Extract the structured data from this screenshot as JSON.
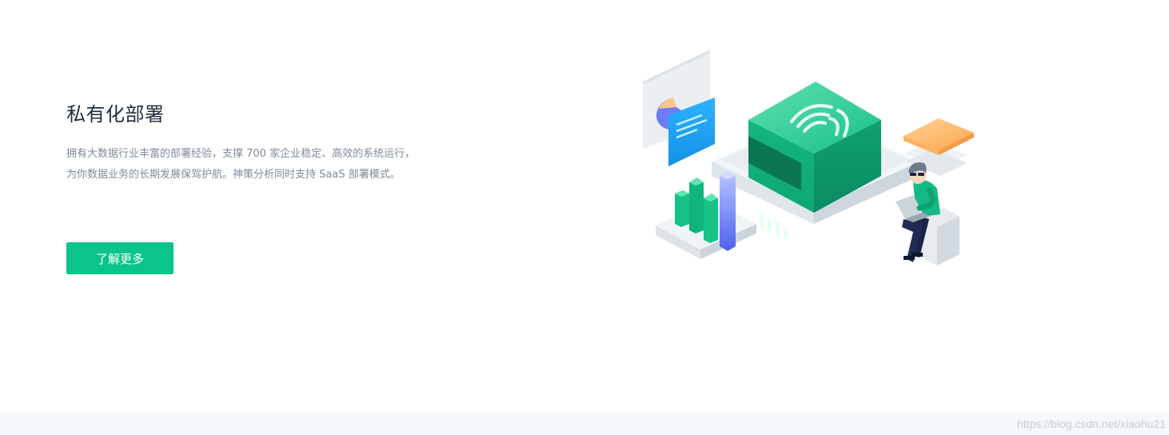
{
  "feature": {
    "title": "私有化部署",
    "description": "拥有大数据行业丰富的部署经验，支撑 700 家企业稳定、高效的系统运行，为你数据业务的长期发展保驾护航。神策分析同时支持 SaaS 部署模式。",
    "cta_label": "了解更多"
  },
  "illustration": {
    "name": "private-deployment-isometric-illustration",
    "colors": {
      "green": "#10b67f",
      "green_light": "#3fd69d",
      "blue": "#1aa2f2",
      "purple_blue": "#5b6ff2",
      "orange": "#ffb66a",
      "gray_platform": "#e9edf0"
    }
  },
  "watermark": "https://blog.csdn.net/xiaohu21"
}
